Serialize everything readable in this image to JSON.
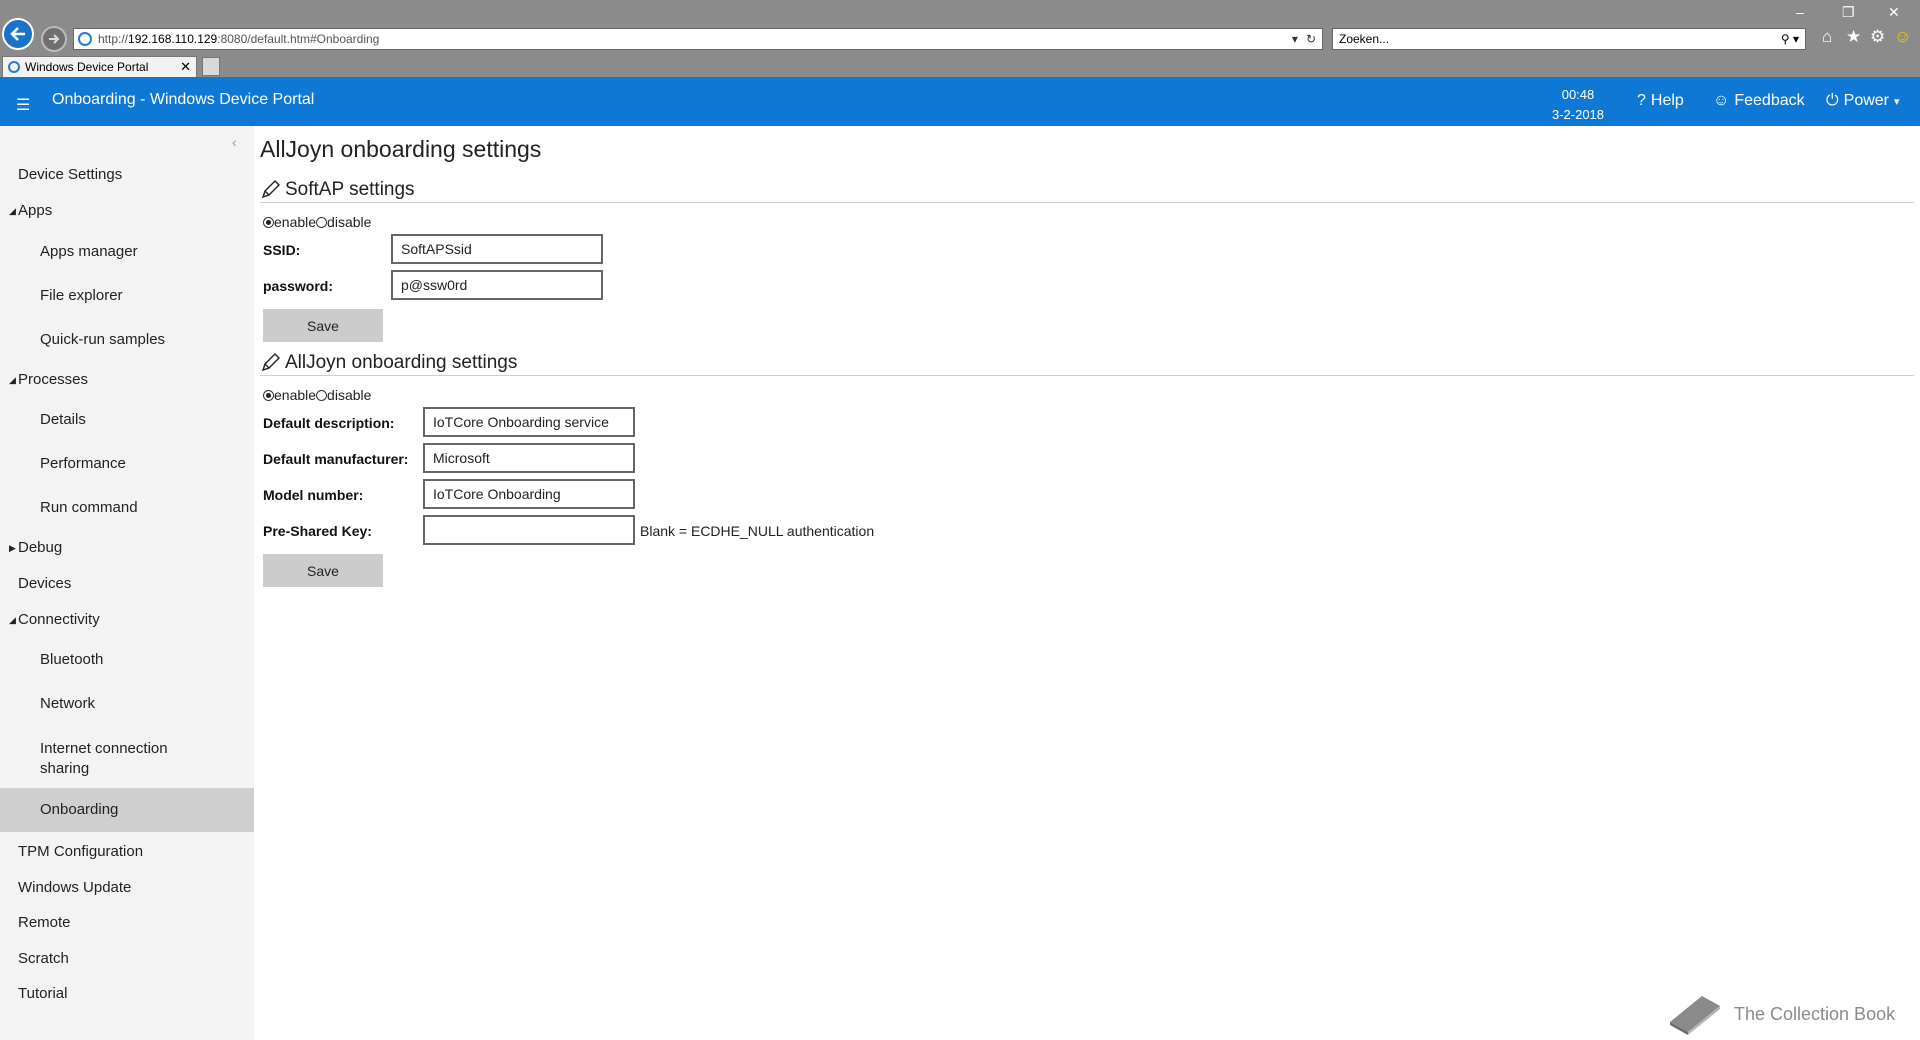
{
  "browser": {
    "url_prefix": "http://",
    "url_host": "192.168.110.129",
    "url_rest": ":8080/default.htm#Onboarding",
    "search_placeholder": "Zoeken...",
    "tab_title": "Windows Device Portal"
  },
  "header": {
    "menu_icon": "hamburger-icon",
    "title": "Onboarding - Windows Device Portal",
    "time": "00:48",
    "date": "3-2-2018",
    "help": "Help",
    "feedback": "Feedback",
    "power": "Power",
    "color": "#0f78d4"
  },
  "sidebar": {
    "items": [
      {
        "label": "Device Settings",
        "level": 1
      },
      {
        "label": "Apps",
        "level": 1,
        "expander": "expanded"
      },
      {
        "label": "Apps manager",
        "level": 2
      },
      {
        "label": "File explorer",
        "level": 2
      },
      {
        "label": "Quick-run samples",
        "level": 2
      },
      {
        "label": "Processes",
        "level": 1,
        "expander": "expanded"
      },
      {
        "label": "Details",
        "level": 2
      },
      {
        "label": "Performance",
        "level": 2
      },
      {
        "label": "Run command",
        "level": 2
      },
      {
        "label": "Debug",
        "level": 1,
        "expander": "collapsed"
      },
      {
        "label": "Devices",
        "level": 1
      },
      {
        "label": "Connectivity",
        "level": 1,
        "expander": "expanded"
      },
      {
        "label": "Bluetooth",
        "level": 2
      },
      {
        "label": "Network",
        "level": 2
      },
      {
        "label": "Internet connection sharing",
        "level": 2
      },
      {
        "label": "Onboarding",
        "level": 2,
        "selected": true
      },
      {
        "label": "TPM Configuration",
        "level": 1
      },
      {
        "label": "Windows Update",
        "level": 1
      },
      {
        "label": "Remote",
        "level": 1
      },
      {
        "label": "Scratch",
        "level": 1
      },
      {
        "label": "Tutorial",
        "level": 1
      }
    ]
  },
  "main": {
    "title": "AllJoyn onboarding settings",
    "softap": {
      "heading": "SoftAP settings",
      "enable_label": "enable",
      "disable_label": "disable",
      "selected": "enable",
      "ssid_label": "SSID:",
      "ssid_value": "SoftAPSsid",
      "password_label": "password:",
      "password_value": "p@ssw0rd",
      "save_label": "Save"
    },
    "alljoyn": {
      "heading": "AllJoyn onboarding settings",
      "enable_label": "enable",
      "disable_label": "disable",
      "selected": "enable",
      "description_label": "Default description:",
      "description_value": "IoTCore Onboarding service",
      "manufacturer_label": "Default manufacturer:",
      "manufacturer_value": "Microsoft",
      "model_label": "Model number:",
      "model_value": "IoTCore Onboarding",
      "psk_label": "Pre-Shared Key:",
      "psk_value": "",
      "psk_hint": "Blank = ECDHE_NULL authentication",
      "save_label": "Save"
    }
  },
  "watermark": {
    "text": "The Collection Book"
  }
}
